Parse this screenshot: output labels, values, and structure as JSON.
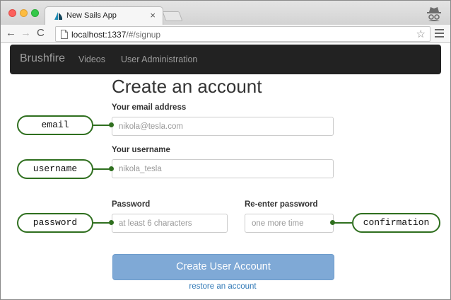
{
  "browser": {
    "tab_title": "New Sails App",
    "tab_close": "×",
    "url_host": "localhost:1337",
    "url_path": "/#/signup",
    "nav_back": "←",
    "nav_forward": "→",
    "nav_reload": "C",
    "star": "☆"
  },
  "navbar": {
    "brand": "Brushfire",
    "links": [
      "Videos",
      "User Administration"
    ]
  },
  "form": {
    "heading": "Create an account",
    "email_label": "Your email address",
    "email_placeholder": "nikola@tesla.com",
    "username_label": "Your username",
    "username_placeholder": "nikola_tesla",
    "password_label": "Password",
    "password_placeholder": "at least 6 characters",
    "confirm_label": "Re-enter password",
    "confirm_placeholder": "one more time",
    "submit_label": "Create User Account",
    "restore_link": "restore an account"
  },
  "callouts": {
    "email": "email",
    "username": "username",
    "password": "password",
    "confirmation": "confirmation"
  },
  "colors": {
    "navbar_bg": "#222222",
    "submit_bg": "#7fa9d6",
    "link": "#337ab7",
    "callout_border": "#2f6f1f"
  }
}
